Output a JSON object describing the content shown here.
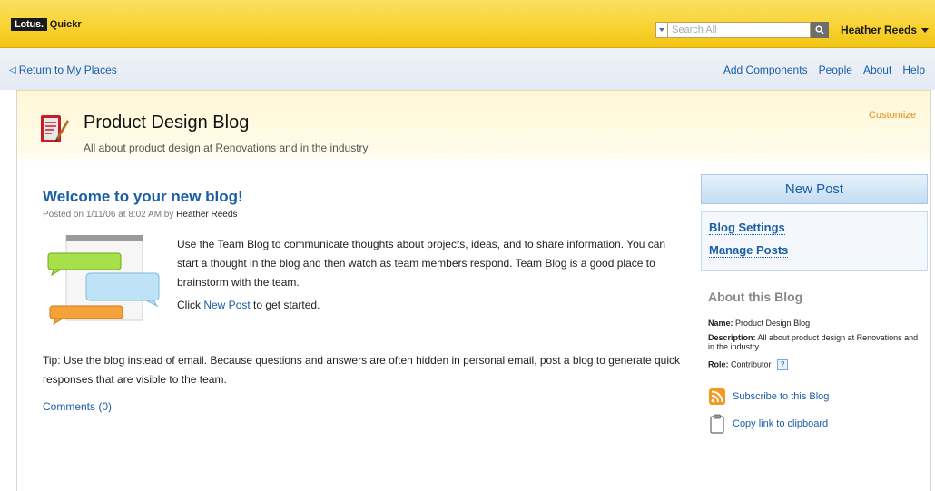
{
  "banner": {
    "logo_brand": "Lotus.",
    "logo_product": "Quickr",
    "search_placeholder": "Search All",
    "user_name": "Heather Reeds"
  },
  "nav": {
    "return_label": "Return to My Places",
    "links": [
      "Add Components",
      "People",
      "About",
      "Help"
    ]
  },
  "header": {
    "title": "Product Design Blog",
    "subtitle": "All about product design at Renovations and in the industry",
    "customize_label": "Customize"
  },
  "post": {
    "title": "Welcome to your new blog!",
    "meta_prefix": "Posted on 1/11/06 at 8:02 AM by",
    "author": "Heather Reeds",
    "paragraph": "Use the Team Blog to communicate thoughts about projects, ideas, and to share information. You can start a thought in the blog and then watch as team members respond.  Team Blog is a good place to brainstorm with the team.",
    "click_prefix": "Click",
    "click_link": "New Post",
    "click_suffix": "to get started.",
    "tip": "Tip: Use the blog instead of email.  Because questions and answers are often hidden in personal email, post a blog to generate quick responses that are visible to the team.",
    "comments_label": "Comments (0)"
  },
  "sidebar": {
    "new_post_label": "New Post",
    "links": [
      "Blog Settings",
      "Manage Posts"
    ],
    "about_title": "About this Blog",
    "name_label": "Name:",
    "name_value": "Product Design Blog",
    "description_label": "Description:",
    "description_value": "All about product design at Renovations and in the industry",
    "role_label": "Role:",
    "role_value": "Contributor",
    "help_mark": "?",
    "subscribe_label": "Subscribe to this Blog",
    "copy_label": "Copy link to clipboard"
  },
  "colors": {
    "banner_yellow": "#f8d333",
    "link_blue": "#1a5ea6",
    "customize_orange": "#e0881b"
  },
  "icons": {
    "search": "search-icon",
    "blog": "blog-icon",
    "rss": "rss-icon",
    "clipboard": "clipboard-icon"
  }
}
